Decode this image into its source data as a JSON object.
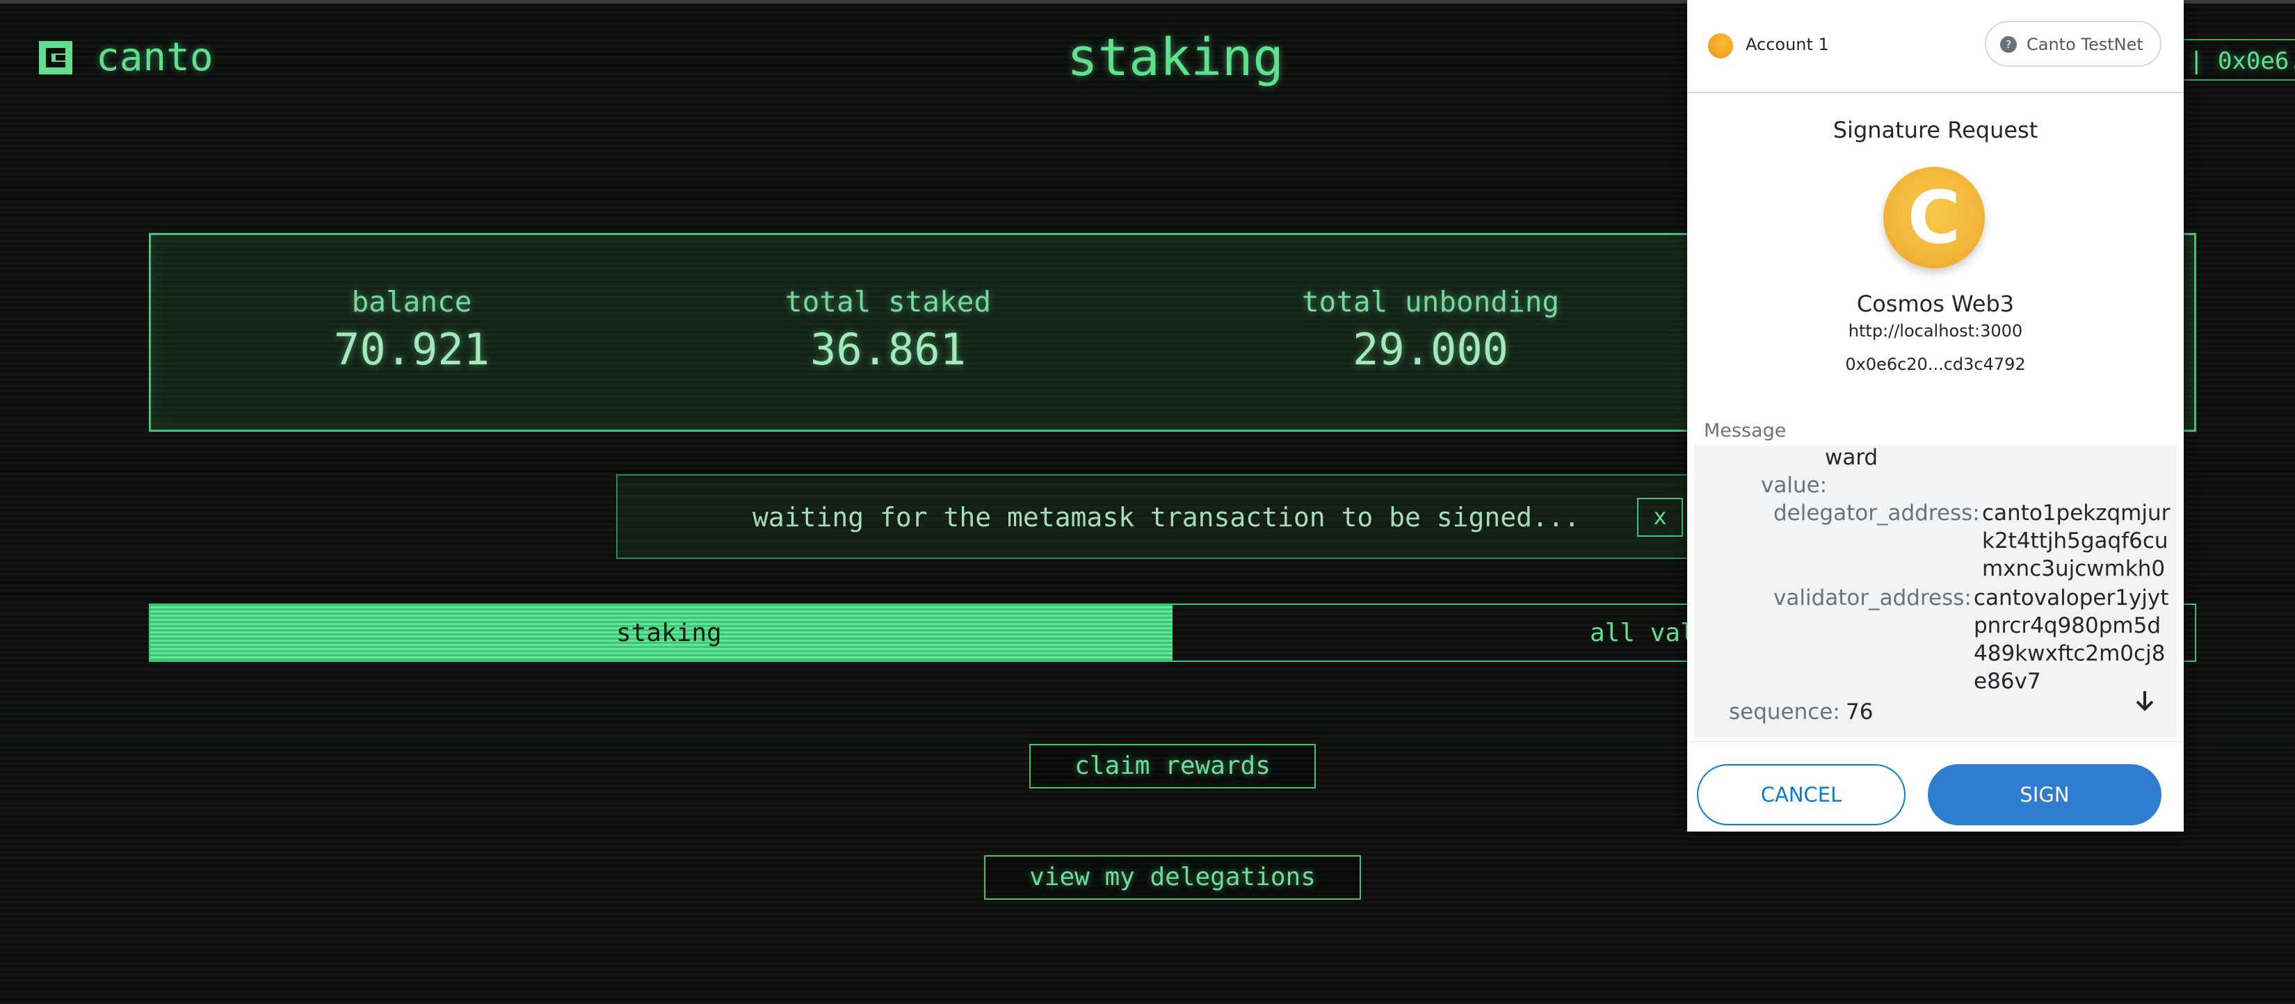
{
  "header": {
    "logo_text": "canto",
    "page_title": "staking",
    "wallet_button": "| 0x0e6."
  },
  "stats": {
    "balance_label": "balance",
    "balance_value": "70.921",
    "staked_label": "total staked",
    "staked_value": "36.861",
    "unbonding_label": "total unbonding",
    "unbonding_value": "29.000"
  },
  "waiting": {
    "text": "waiting for the metamask transaction to be signed...",
    "close_label": "x"
  },
  "tabs": [
    {
      "label": "staking",
      "active": true
    },
    {
      "label": "all vali",
      "active": false
    }
  ],
  "actions": {
    "claim_rewards": "claim rewards",
    "view_delegations": "view my delegations"
  },
  "metamask": {
    "account_name": "Account 1",
    "network_icon": "?",
    "network": "Canto TestNet",
    "title": "Signature Request",
    "site_logo_letter": "C",
    "site_name": "Cosmos Web3",
    "site_url": "http://localhost:3000",
    "address": "0x0e6c20...cd3c4792",
    "message_label": "Message",
    "message": {
      "type_fragment": "ward",
      "value_key": "value:",
      "delegator_key": "delegator_address:",
      "delegator_lines": [
        "canto1pekzqmjur",
        "k2t4ttjh5gaqf6cu",
        "mxnc3ujcwmkh0"
      ],
      "validator_key": "validator_address:",
      "validator_lines": [
        "cantovaloper1yjyt",
        "pnrcr4q980pm5d",
        "489kwxftc2m0cj8",
        "e86v7"
      ],
      "sequence_key": "sequence:",
      "sequence_value": "76"
    },
    "cancel_label": "CANCEL",
    "sign_label": "SIGN"
  },
  "colors": {
    "accent_green": "#5fe08f",
    "background": "#0c0f0c",
    "metamask_blue": "#037dd6"
  }
}
